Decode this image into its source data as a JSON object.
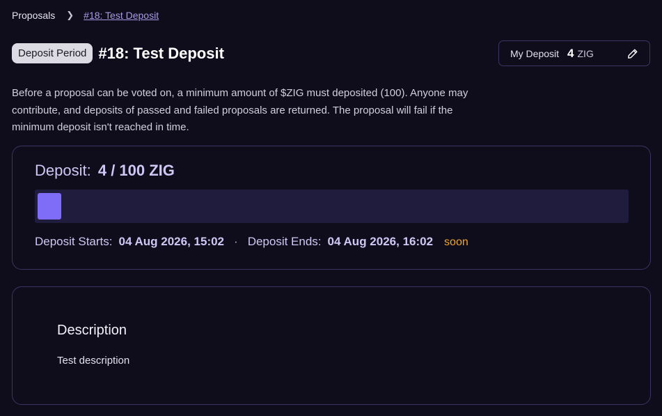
{
  "breadcrumb": {
    "root": "Proposals",
    "current": "#18: Test Deposit"
  },
  "header": {
    "status_badge": "Deposit Period",
    "title": "#18: Test Deposit"
  },
  "my_deposit": {
    "label": "My Deposit",
    "amount": "4",
    "unit": "ZIG",
    "edit_icon": "pencil-icon"
  },
  "intro": "Before a proposal can be voted on, a minimum amount of $ZIG must deposited (100). Anyone may contribute, and deposits of passed and failed proposals are returned. The proposal will fail if the minimum deposit isn't reached in time.",
  "deposit": {
    "label": "Deposit:",
    "value_text": "4 / 100 ZIG",
    "current": 4,
    "target": 100,
    "starts_label": "Deposit Starts:",
    "starts_value": "04 Aug 2026, 15:02",
    "separator": "·",
    "ends_label": "Deposit Ends:",
    "ends_value": "04 Aug 2026, 16:02",
    "ends_note": "soon"
  },
  "description": {
    "heading": "Description",
    "text": "Test description"
  },
  "colors": {
    "accent": "#7f6cf7",
    "soon": "#f0a627",
    "background": "#0f0d1b",
    "border": "#3a3564"
  }
}
